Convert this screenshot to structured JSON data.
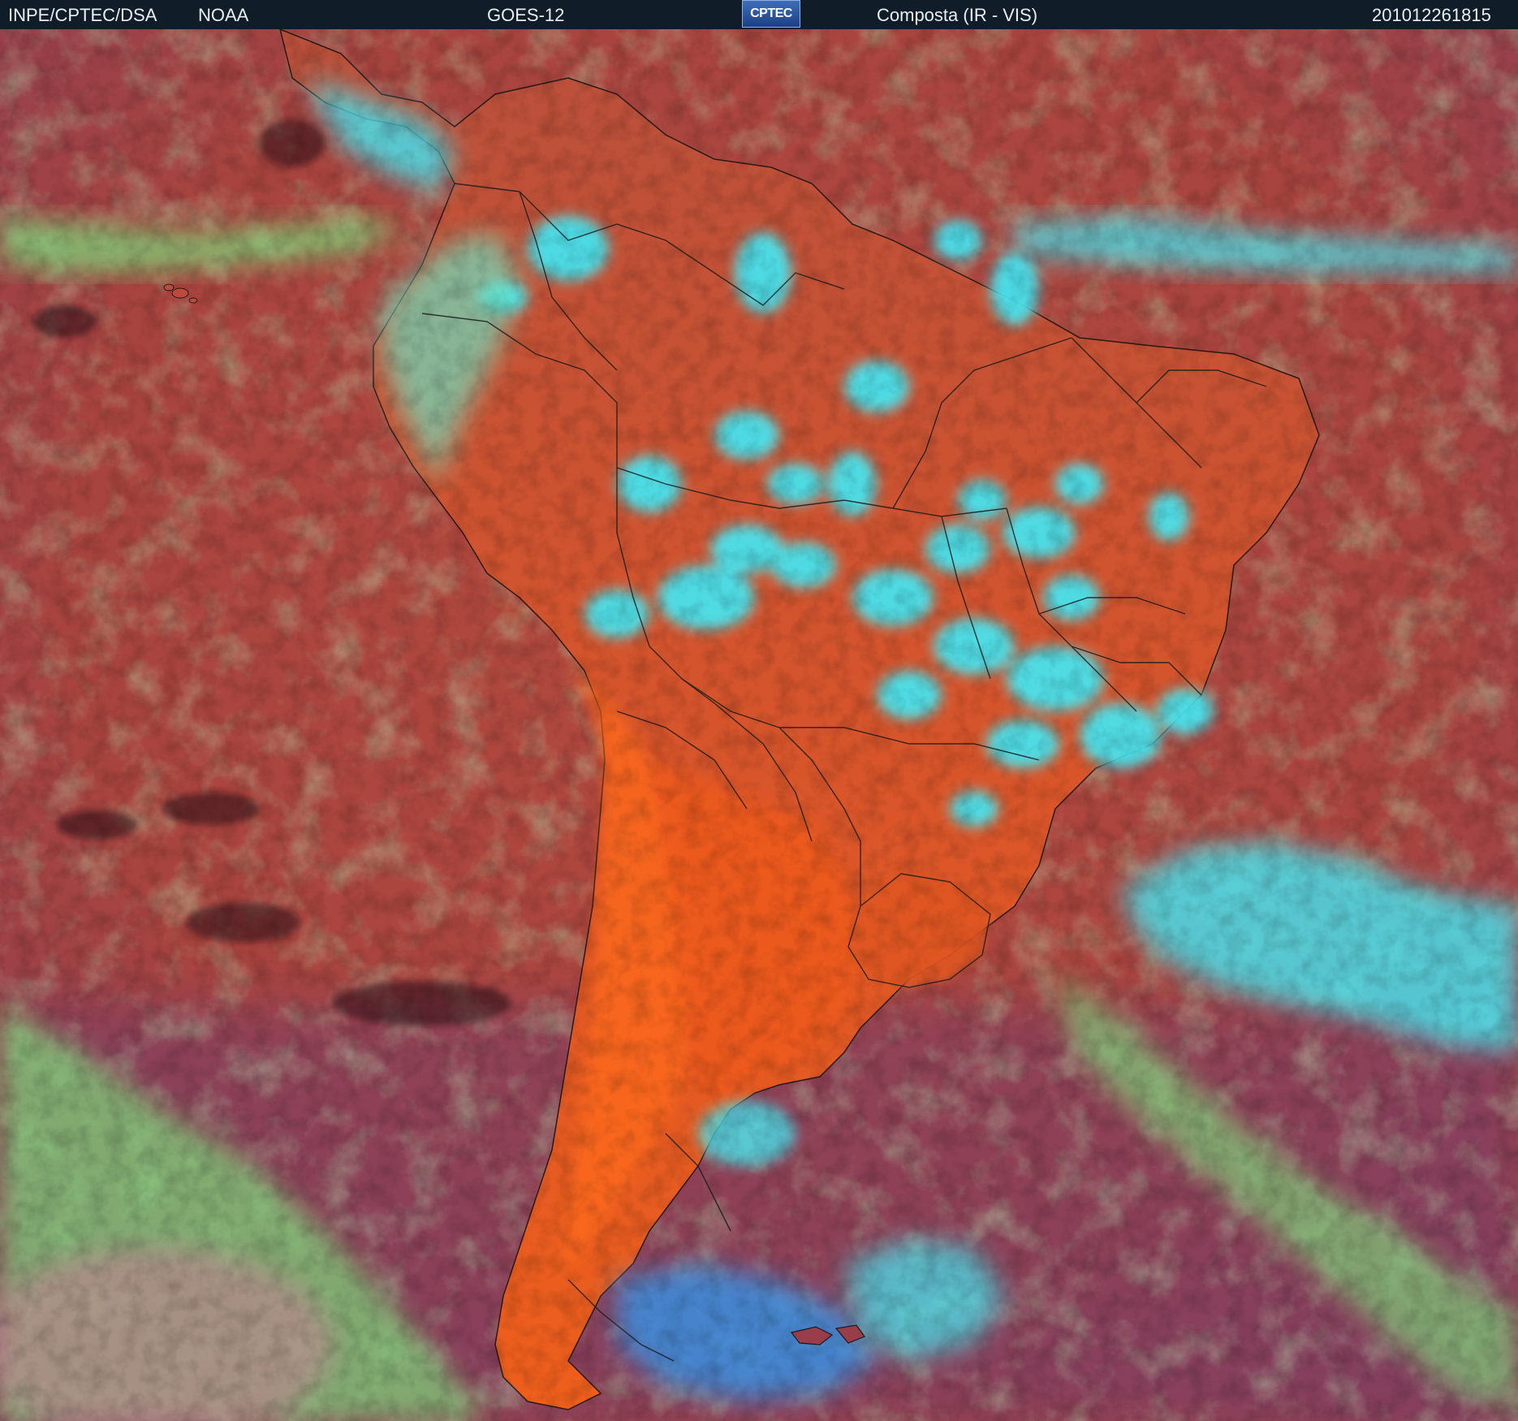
{
  "header": {
    "source": "INPE/CPTEC/DSA",
    "agency": "NOAA",
    "satellite": "GOES-12",
    "logo_text": "CPTEC",
    "product": "Composta (IR - VIS)",
    "timestamp": "201012261815"
  },
  "image": {
    "type": "satellite composite image",
    "region": "South America",
    "colors": {
      "clear_ocean": "#a8443f",
      "clear_land": "#e8581f",
      "low_cloud": "#7fd67a",
      "high_cloud": "#44e6f2",
      "cold_cloud": "#3a8fe0",
      "border_lines": "#1a1a1a"
    }
  }
}
